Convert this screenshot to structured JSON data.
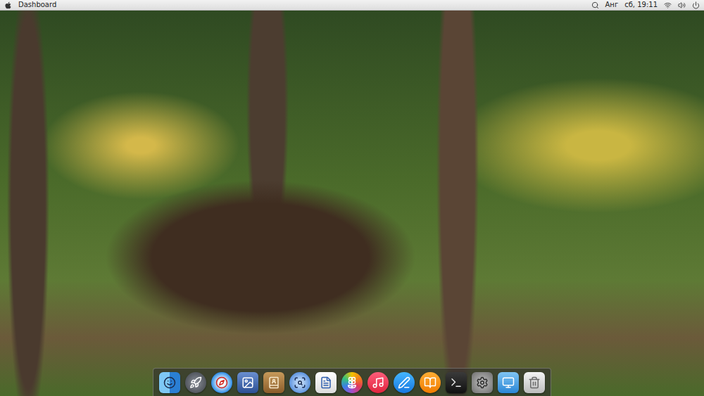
{
  "top_bar": {
    "app_menu": "Dashboard",
    "keyboard_layout": "Анг",
    "clock": "сб, 19:11"
  },
  "dock": {
    "items": [
      {
        "kind": "finder"
      },
      {
        "kind": "launchpad"
      },
      {
        "kind": "safari"
      },
      {
        "kind": "preview"
      },
      {
        "kind": "contacts"
      },
      {
        "kind": "quicktime"
      },
      {
        "kind": "textedit"
      },
      {
        "kind": "photos"
      },
      {
        "kind": "music"
      },
      {
        "kind": "appstore"
      },
      {
        "kind": "books"
      },
      {
        "kind": "terminal"
      },
      {
        "kind": "settings"
      },
      {
        "kind": "desktop"
      },
      {
        "kind": "trash"
      }
    ]
  }
}
